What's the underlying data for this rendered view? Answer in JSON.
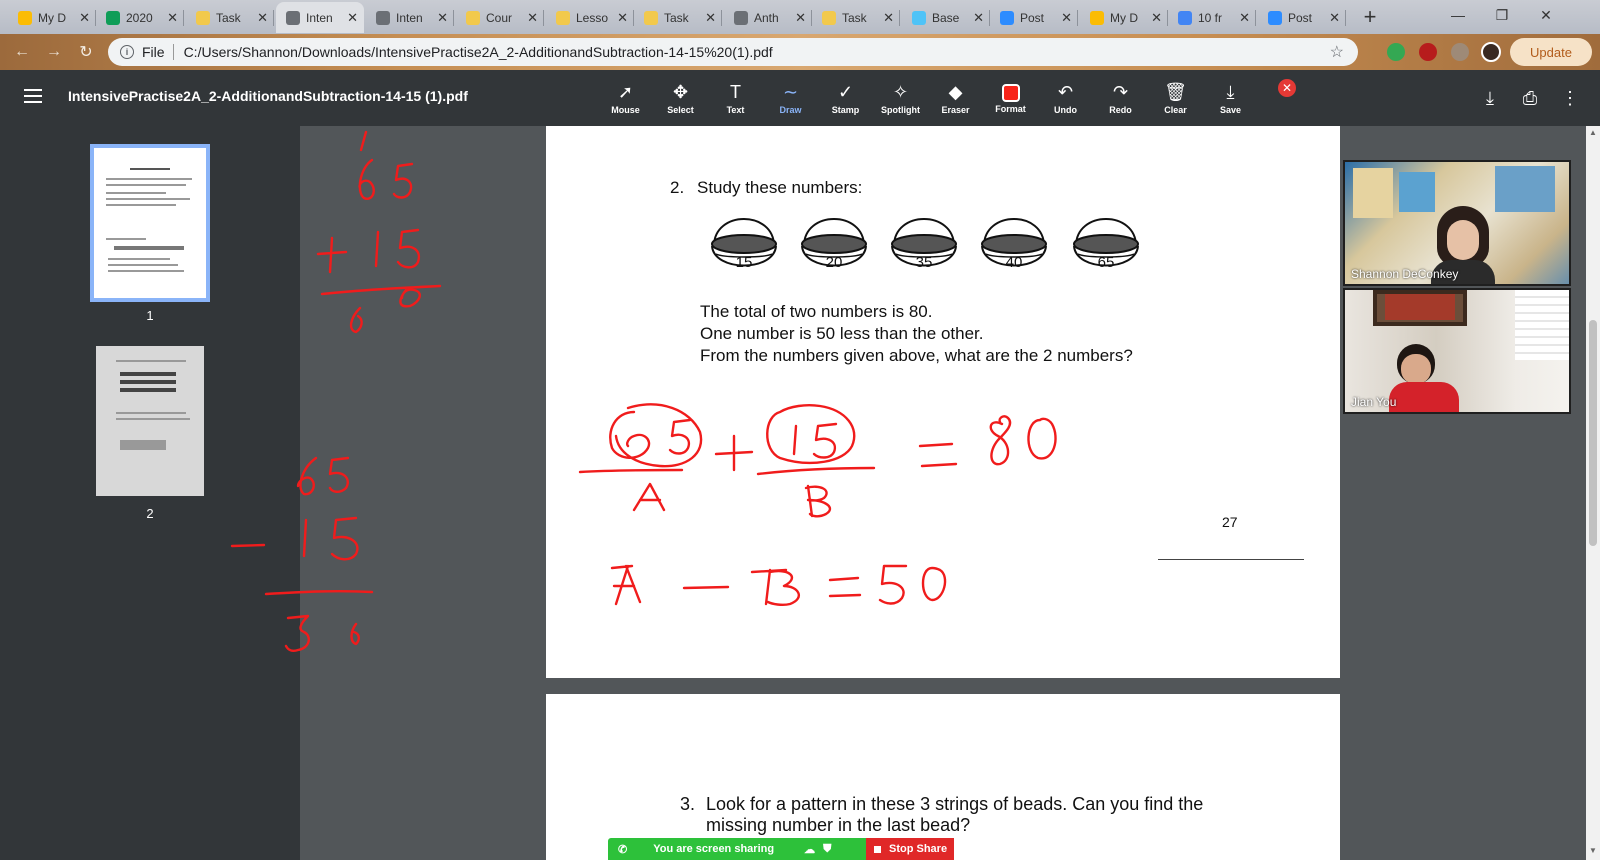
{
  "browser": {
    "tabs": [
      {
        "label": "My D",
        "favicon": "drive-icon",
        "color": "#fbbc04"
      },
      {
        "label": "2020",
        "favicon": "sheets-icon",
        "color": "#0f9d58"
      },
      {
        "label": "Task",
        "favicon": "lesson-icon",
        "color": "#f2c94c"
      },
      {
        "label": "Inten",
        "favicon": "globe-icon",
        "color": "#6b6f75"
      },
      {
        "label": "Inten",
        "favicon": "globe-icon",
        "color": "#6b6f75"
      },
      {
        "label": "Cour",
        "favicon": "lesson-icon",
        "color": "#f2c94c"
      },
      {
        "label": "Lesso",
        "favicon": "lesson-icon",
        "color": "#f2c94c"
      },
      {
        "label": "Task",
        "favicon": "lesson-icon",
        "color": "#f2c94c"
      },
      {
        "label": "Anth",
        "favicon": "globe-icon",
        "color": "#6b6f75"
      },
      {
        "label": "Task",
        "favicon": "lesson-icon",
        "color": "#f2c94c"
      },
      {
        "label": "Base",
        "favicon": "base-icon",
        "color": "#4fc3f7"
      },
      {
        "label": "Post",
        "favicon": "zoom-icon",
        "color": "#2d8cff"
      },
      {
        "label": "My D",
        "favicon": "drive-icon",
        "color": "#fbbc04"
      },
      {
        "label": "10 fr",
        "favicon": "docs-icon",
        "color": "#4285f4"
      },
      {
        "label": "Post",
        "favicon": "zoom-icon",
        "color": "#2d8cff"
      }
    ],
    "address": {
      "scheme": "File",
      "url": "C:/Users/Shannon/Downloads/IntensivePractise2A_2-AdditionandSubtraction-14-15%20(1).pdf"
    },
    "update_label": "Update"
  },
  "pdf": {
    "title": "IntensivePractise2A_2-AdditionandSubtraction-14-15 (1).pdf",
    "tools": [
      {
        "label": "Mouse",
        "icon": "cursor-icon",
        "glyph": "➚"
      },
      {
        "label": "Select",
        "icon": "move-icon",
        "glyph": "✥"
      },
      {
        "label": "Text",
        "icon": "text-icon",
        "glyph": "T"
      },
      {
        "label": "Draw",
        "icon": "draw-icon",
        "glyph": "∼"
      },
      {
        "label": "Stamp",
        "icon": "check-icon",
        "glyph": "✓"
      },
      {
        "label": "Spotlight",
        "icon": "wand-icon",
        "glyph": "✧"
      },
      {
        "label": "Eraser",
        "icon": "eraser-icon",
        "glyph": "◆"
      },
      {
        "label": "Format",
        "icon": "format-swatch-icon",
        "glyph": ""
      },
      {
        "label": "Undo",
        "icon": "undo-icon",
        "glyph": "↶"
      },
      {
        "label": "Redo",
        "icon": "redo-icon",
        "glyph": "↷"
      },
      {
        "label": "Clear",
        "icon": "trash-icon",
        "glyph": "🗑"
      },
      {
        "label": "Save",
        "icon": "save-icon",
        "glyph": "⤓"
      }
    ],
    "thumbnails": [
      {
        "number": "1"
      },
      {
        "number": "2"
      }
    ],
    "page1": {
      "question_number": "2.",
      "question": "Study these numbers:",
      "baskets": [
        "15",
        "20",
        "35",
        "40",
        "65"
      ],
      "line1": "The total of two numbers is 80.",
      "line2": "One number is 50 less than the other.",
      "line3": "From the numbers given above, what are the 2 numbers?",
      "page_number": "27"
    },
    "page2": {
      "question_number": "3.",
      "line1": "Look for a pattern in these 3 strings of beads. Can you find the",
      "line2": "missing number in the last bead?"
    }
  },
  "video": {
    "participants": [
      {
        "name": "Shannon DeConkey"
      },
      {
        "name": "Jian You"
      }
    ]
  },
  "share": {
    "status": "You are screen sharing",
    "stop_label": "Stop Share"
  },
  "colors": {
    "ink": "#f01c1c",
    "accent": "#8ab4f8"
  }
}
